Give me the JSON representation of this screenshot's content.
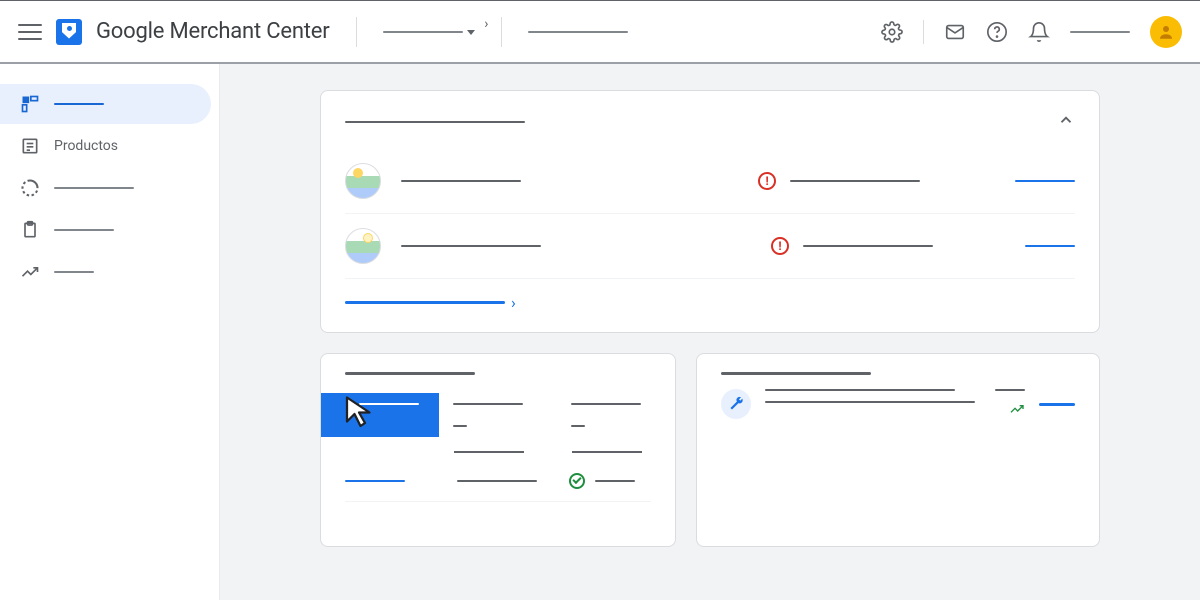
{
  "header": {
    "app_title": "Google Merchant Center"
  },
  "sidebar": {
    "items": [
      {
        "icon": "dashboard",
        "label": ""
      },
      {
        "icon": "list",
        "label": "Productos"
      },
      {
        "icon": "donut",
        "label": ""
      },
      {
        "icon": "clipboard",
        "label": ""
      },
      {
        "icon": "trend",
        "label": ""
      }
    ]
  },
  "issues_card": {
    "title": "",
    "rows": [
      {
        "alert": true
      },
      {
        "alert": true
      }
    ],
    "footer_link": ""
  }
}
